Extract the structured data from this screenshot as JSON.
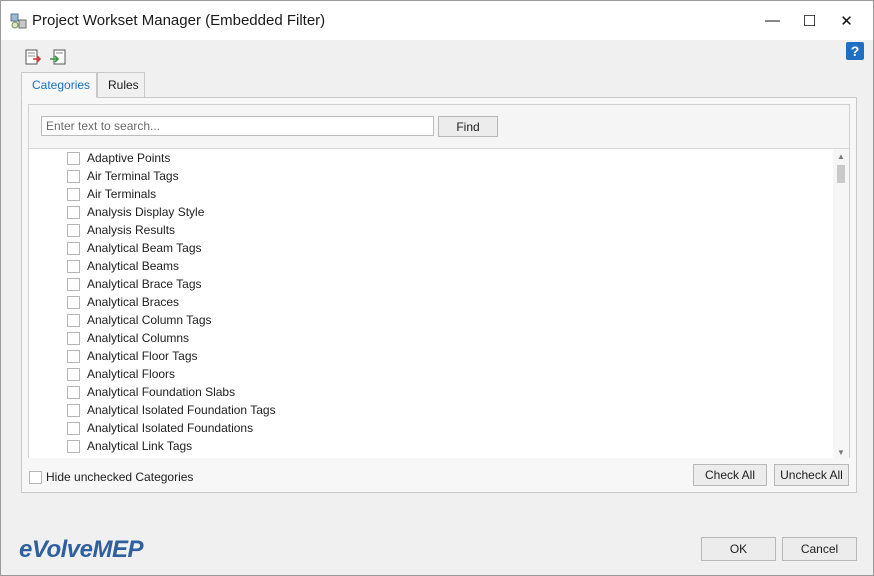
{
  "window": {
    "title": "Project Workset Manager (Embedded Filter)",
    "minimize_glyph": "—",
    "maximize_glyph": "☐",
    "close_glyph": "✕"
  },
  "help": {
    "glyph": "?"
  },
  "toolbar": {
    "export_icon": "export-icon",
    "import_icon": "import-icon"
  },
  "tabs": [
    {
      "label": "Categories",
      "active": true
    },
    {
      "label": "Rules",
      "active": false
    }
  ],
  "search": {
    "placeholder": "Enter text to search...",
    "value": "",
    "find_label": "Find"
  },
  "categories": {
    "items": [
      {
        "label": "Adaptive Points",
        "checked": false
      },
      {
        "label": "Air Terminal Tags",
        "checked": false
      },
      {
        "label": "Air Terminals",
        "checked": false
      },
      {
        "label": "Analysis Display Style",
        "checked": false
      },
      {
        "label": "Analysis Results",
        "checked": false
      },
      {
        "label": "Analytical Beam Tags",
        "checked": false
      },
      {
        "label": "Analytical Beams",
        "checked": false
      },
      {
        "label": "Analytical Brace Tags",
        "checked": false
      },
      {
        "label": "Analytical Braces",
        "checked": false
      },
      {
        "label": "Analytical Column Tags",
        "checked": false
      },
      {
        "label": "Analytical Columns",
        "checked": false
      },
      {
        "label": "Analytical Floor Tags",
        "checked": false
      },
      {
        "label": "Analytical Floors",
        "checked": false
      },
      {
        "label": "Analytical Foundation Slabs",
        "checked": false
      },
      {
        "label": "Analytical Isolated Foundation Tags",
        "checked": false
      },
      {
        "label": "Analytical Isolated Foundations",
        "checked": false
      },
      {
        "label": "Analytical Link Tags",
        "checked": false
      }
    ]
  },
  "footer_panel": {
    "hide_unchecked_label": "Hide unchecked Categories",
    "hide_unchecked_checked": false,
    "check_all_label": "Check All",
    "uncheck_all_label": "Uncheck All"
  },
  "brand": {
    "logo_text": "eVolveMEP",
    "color": "#2f5f9e"
  },
  "dialog": {
    "ok_label": "OK",
    "cancel_label": "Cancel"
  },
  "colors": {
    "accent": "#1b6fc2",
    "help_bg": "#1f6fc5"
  }
}
